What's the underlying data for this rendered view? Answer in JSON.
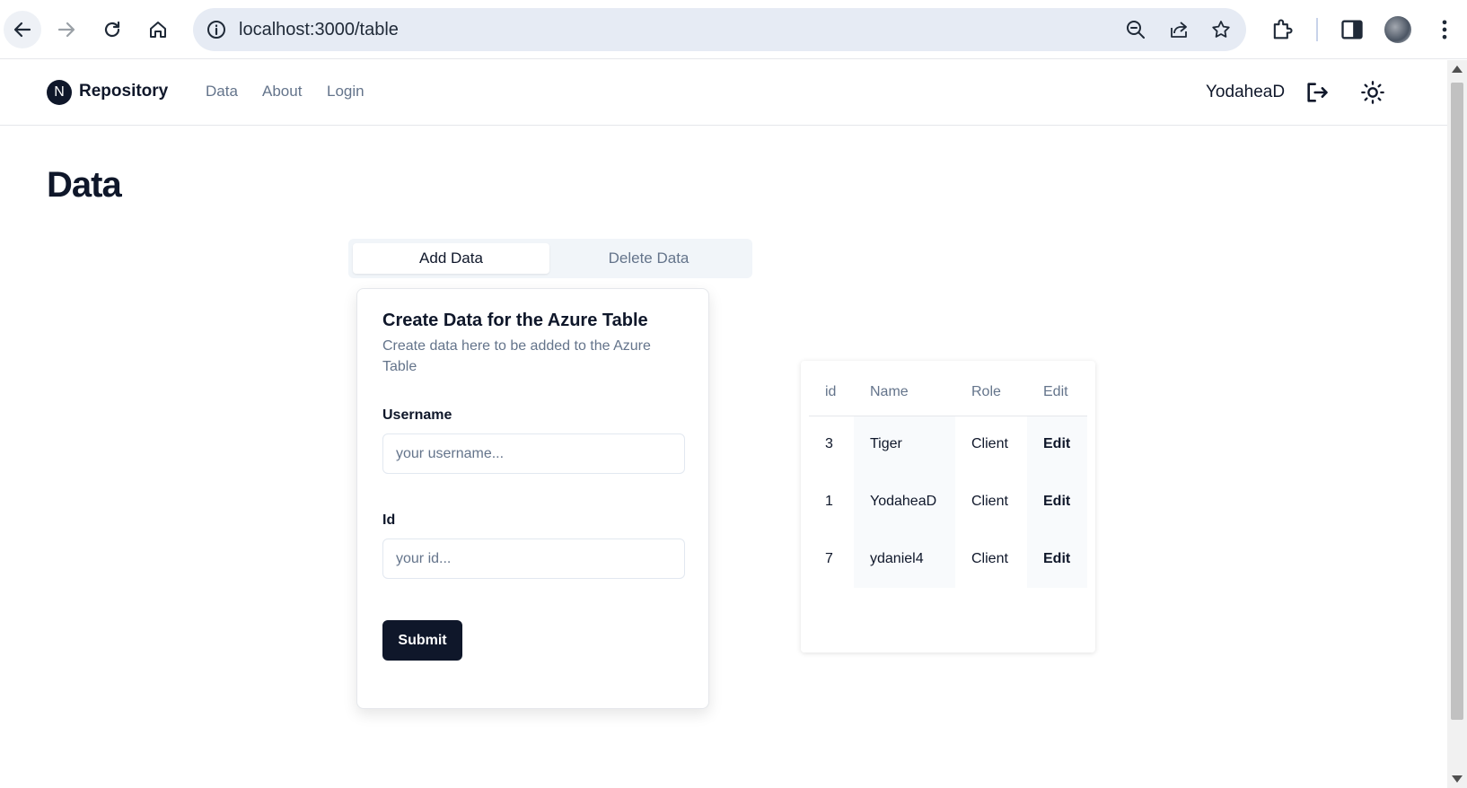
{
  "browser": {
    "url": "localhost:3000/table"
  },
  "nav": {
    "logo_letter": "N",
    "brand": "Repository",
    "links": [
      "Data",
      "About",
      "Login"
    ],
    "username": "YodaheaD"
  },
  "page": {
    "title": "Data"
  },
  "tabs": {
    "add": "Add Data",
    "delete": "Delete Data"
  },
  "form": {
    "title": "Create Data for the Azure Table",
    "description": "Create data here to be added to the Azure Table",
    "username_label": "Username",
    "username_placeholder": "your username...",
    "id_label": "Id",
    "id_placeholder": "your id...",
    "submit_label": "Submit"
  },
  "table": {
    "headers": [
      "id",
      "Name",
      "Role",
      "Edit"
    ],
    "rows": [
      {
        "id": "3",
        "name": "Tiger",
        "role": "Client",
        "edit": "Edit"
      },
      {
        "id": "1",
        "name": "YodaheaD",
        "role": "Client",
        "edit": "Edit"
      },
      {
        "id": "7",
        "name": "ydaniel4",
        "role": "Client",
        "edit": "Edit"
      }
    ]
  },
  "colors": {
    "primary": "#0f172a",
    "muted": "#64748b",
    "omnibox": "#e6ebf4"
  }
}
